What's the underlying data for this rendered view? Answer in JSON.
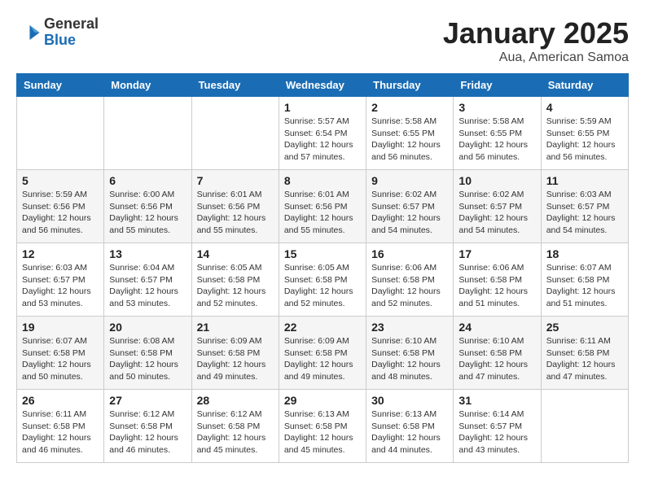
{
  "logo": {
    "general": "General",
    "blue": "Blue"
  },
  "title": "January 2025",
  "subtitle": "Aua, American Samoa",
  "headers": [
    "Sunday",
    "Monday",
    "Tuesday",
    "Wednesday",
    "Thursday",
    "Friday",
    "Saturday"
  ],
  "weeks": [
    [
      {
        "day": "",
        "info": ""
      },
      {
        "day": "",
        "info": ""
      },
      {
        "day": "",
        "info": ""
      },
      {
        "day": "1",
        "info": "Sunrise: 5:57 AM\nSunset: 6:54 PM\nDaylight: 12 hours\nand 57 minutes."
      },
      {
        "day": "2",
        "info": "Sunrise: 5:58 AM\nSunset: 6:55 PM\nDaylight: 12 hours\nand 56 minutes."
      },
      {
        "day": "3",
        "info": "Sunrise: 5:58 AM\nSunset: 6:55 PM\nDaylight: 12 hours\nand 56 minutes."
      },
      {
        "day": "4",
        "info": "Sunrise: 5:59 AM\nSunset: 6:55 PM\nDaylight: 12 hours\nand 56 minutes."
      }
    ],
    [
      {
        "day": "5",
        "info": "Sunrise: 5:59 AM\nSunset: 6:56 PM\nDaylight: 12 hours\nand 56 minutes."
      },
      {
        "day": "6",
        "info": "Sunrise: 6:00 AM\nSunset: 6:56 PM\nDaylight: 12 hours\nand 55 minutes."
      },
      {
        "day": "7",
        "info": "Sunrise: 6:01 AM\nSunset: 6:56 PM\nDaylight: 12 hours\nand 55 minutes."
      },
      {
        "day": "8",
        "info": "Sunrise: 6:01 AM\nSunset: 6:56 PM\nDaylight: 12 hours\nand 55 minutes."
      },
      {
        "day": "9",
        "info": "Sunrise: 6:02 AM\nSunset: 6:57 PM\nDaylight: 12 hours\nand 54 minutes."
      },
      {
        "day": "10",
        "info": "Sunrise: 6:02 AM\nSunset: 6:57 PM\nDaylight: 12 hours\nand 54 minutes."
      },
      {
        "day": "11",
        "info": "Sunrise: 6:03 AM\nSunset: 6:57 PM\nDaylight: 12 hours\nand 54 minutes."
      }
    ],
    [
      {
        "day": "12",
        "info": "Sunrise: 6:03 AM\nSunset: 6:57 PM\nDaylight: 12 hours\nand 53 minutes."
      },
      {
        "day": "13",
        "info": "Sunrise: 6:04 AM\nSunset: 6:57 PM\nDaylight: 12 hours\nand 53 minutes."
      },
      {
        "day": "14",
        "info": "Sunrise: 6:05 AM\nSunset: 6:58 PM\nDaylight: 12 hours\nand 52 minutes."
      },
      {
        "day": "15",
        "info": "Sunrise: 6:05 AM\nSunset: 6:58 PM\nDaylight: 12 hours\nand 52 minutes."
      },
      {
        "day": "16",
        "info": "Sunrise: 6:06 AM\nSunset: 6:58 PM\nDaylight: 12 hours\nand 52 minutes."
      },
      {
        "day": "17",
        "info": "Sunrise: 6:06 AM\nSunset: 6:58 PM\nDaylight: 12 hours\nand 51 minutes."
      },
      {
        "day": "18",
        "info": "Sunrise: 6:07 AM\nSunset: 6:58 PM\nDaylight: 12 hours\nand 51 minutes."
      }
    ],
    [
      {
        "day": "19",
        "info": "Sunrise: 6:07 AM\nSunset: 6:58 PM\nDaylight: 12 hours\nand 50 minutes."
      },
      {
        "day": "20",
        "info": "Sunrise: 6:08 AM\nSunset: 6:58 PM\nDaylight: 12 hours\nand 50 minutes."
      },
      {
        "day": "21",
        "info": "Sunrise: 6:09 AM\nSunset: 6:58 PM\nDaylight: 12 hours\nand 49 minutes."
      },
      {
        "day": "22",
        "info": "Sunrise: 6:09 AM\nSunset: 6:58 PM\nDaylight: 12 hours\nand 49 minutes."
      },
      {
        "day": "23",
        "info": "Sunrise: 6:10 AM\nSunset: 6:58 PM\nDaylight: 12 hours\nand 48 minutes."
      },
      {
        "day": "24",
        "info": "Sunrise: 6:10 AM\nSunset: 6:58 PM\nDaylight: 12 hours\nand 47 minutes."
      },
      {
        "day": "25",
        "info": "Sunrise: 6:11 AM\nSunset: 6:58 PM\nDaylight: 12 hours\nand 47 minutes."
      }
    ],
    [
      {
        "day": "26",
        "info": "Sunrise: 6:11 AM\nSunset: 6:58 PM\nDaylight: 12 hours\nand 46 minutes."
      },
      {
        "day": "27",
        "info": "Sunrise: 6:12 AM\nSunset: 6:58 PM\nDaylight: 12 hours\nand 46 minutes."
      },
      {
        "day": "28",
        "info": "Sunrise: 6:12 AM\nSunset: 6:58 PM\nDaylight: 12 hours\nand 45 minutes."
      },
      {
        "day": "29",
        "info": "Sunrise: 6:13 AM\nSunset: 6:58 PM\nDaylight: 12 hours\nand 45 minutes."
      },
      {
        "day": "30",
        "info": "Sunrise: 6:13 AM\nSunset: 6:58 PM\nDaylight: 12 hours\nand 44 minutes."
      },
      {
        "day": "31",
        "info": "Sunrise: 6:14 AM\nSunset: 6:57 PM\nDaylight: 12 hours\nand 43 minutes."
      },
      {
        "day": "",
        "info": ""
      }
    ]
  ]
}
